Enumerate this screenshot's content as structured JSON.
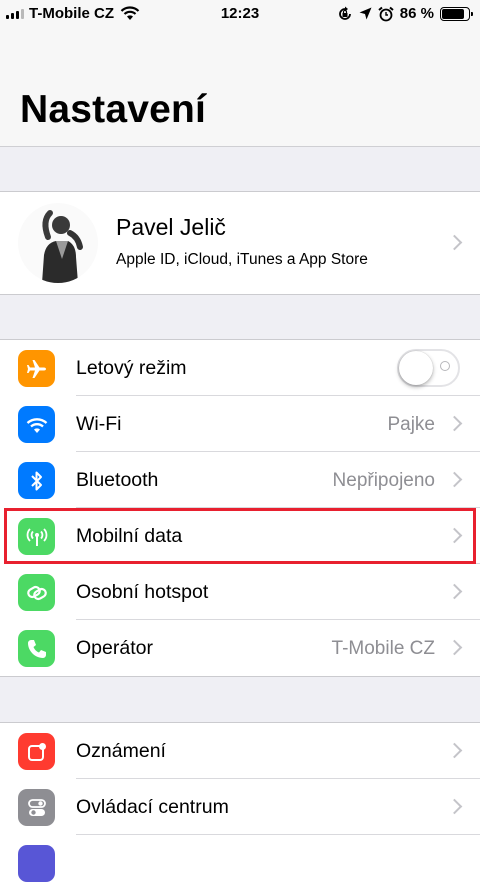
{
  "status_bar": {
    "carrier": "T-Mobile CZ",
    "time": "12:23",
    "battery_text": "86 %",
    "battery_level": 0.86
  },
  "header": {
    "title": "Nastavení"
  },
  "profile": {
    "name": "Pavel Jelič",
    "subtitle": "Apple ID, iCloud, iTunes a App Store"
  },
  "group1": [
    {
      "label": "Letový režim",
      "icon": "airplane-icon",
      "color": "#ff9500",
      "toggle": false
    },
    {
      "label": "Wi-Fi",
      "value": "Pajke",
      "icon": "wifi-icon",
      "color": "#007aff"
    },
    {
      "label": "Bluetooth",
      "value": "Nepřipojeno",
      "icon": "bluetooth-icon",
      "color": "#007aff"
    },
    {
      "label": "Mobilní data",
      "icon": "cellular-antenna-icon",
      "color": "#4cd964",
      "highlighted": true
    },
    {
      "label": "Osobní hotspot",
      "icon": "hotspot-link-icon",
      "color": "#4cd964"
    },
    {
      "label": "Operátor",
      "value": "T-Mobile CZ",
      "icon": "phone-icon",
      "color": "#4cd964"
    }
  ],
  "group2": [
    {
      "label": "Oznámení",
      "icon": "notifications-icon",
      "color": "#ff3b30"
    },
    {
      "label": "Ovládací centrum",
      "icon": "control-center-icon",
      "color": "#8e8e93"
    }
  ],
  "highlight_color": "#e8202f"
}
